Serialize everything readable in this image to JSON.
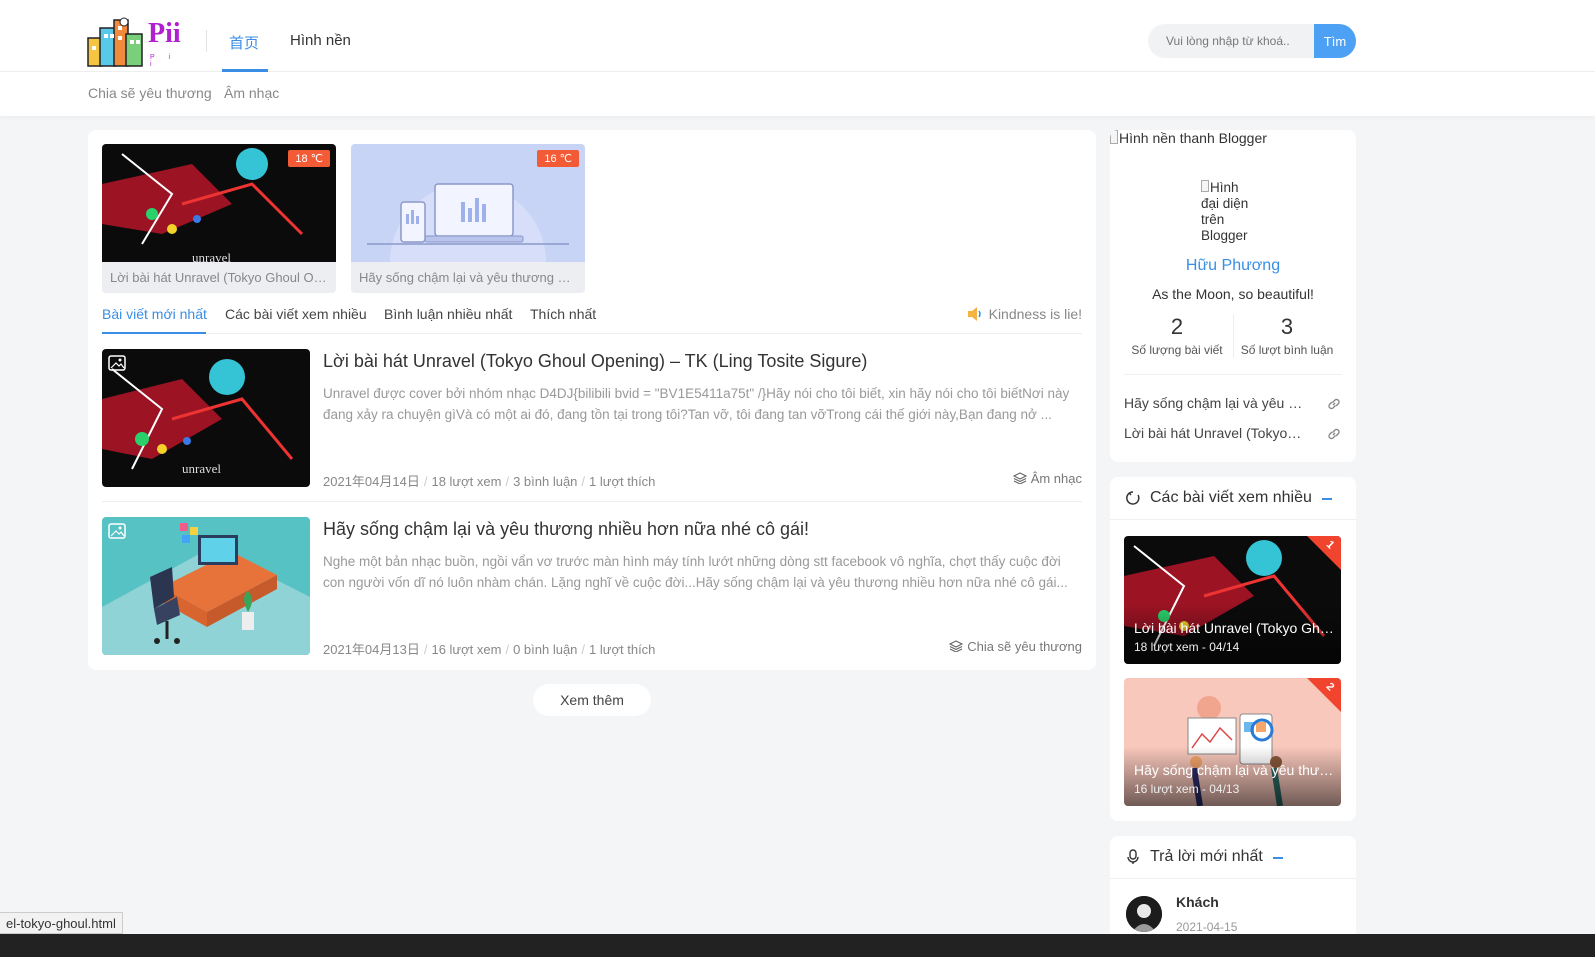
{
  "header": {
    "logo_text": "Pii",
    "logo_sub": "P i i",
    "nav": [
      "首页",
      "Hình nền"
    ],
    "search_placeholder": "Vui lòng nhập từ khoá..",
    "search_button": "Tìm"
  },
  "subnav": [
    "Chia sẽ yêu thương",
    "Âm nhạc"
  ],
  "featured": [
    {
      "caption": "Lời bài hát Unravel (Tokyo Ghoul Opening) – TK",
      "temp": "18 ℃"
    },
    {
      "caption": "Hãy sống chậm lại và yêu thương nhiều hơn nữa",
      "temp": "16 ℃"
    }
  ],
  "tabs": [
    "Bài viết mới nhất",
    "Các bài viết xem nhiều",
    "Bình luận nhiều nhất",
    "Thích nhất"
  ],
  "kindness": "Kindness is lie!",
  "posts": [
    {
      "title": "Lời bài hát Unravel (Tokyo Ghoul Opening) – TK (Ling Tosite Sigure)",
      "excerpt": "Unravel được cover bởi nhóm nhạc D4DJ{bilibili bvid = \"BV1E5411a75t\" /}Hãy nói cho tôi biết, xin hãy nói cho tôi biếtNơi này đang xảy ra chuyện gìVà có một ai đó, đang tồn tại trong tôi?Tan vỡ, tôi đang tan vỡTrong cái thế giới này,Bạn đang nở ...",
      "date": "2021年04月14日",
      "views": "18 lượt xem",
      "comments": "3 bình luận",
      "likes": "1 lượt thích",
      "category": "Âm nhạc"
    },
    {
      "title": "Hãy sống chậm lại và yêu thương nhiều hơn nữa nhé cô gái!",
      "excerpt": "Nghe một bản nhạc buồn, ngồi vẩn vơ trước màn hình máy tính lướt những dòng stt facebook vô nghĩa, chợt thấy cuộc đời con người vốn dĩ nó luôn nhàm chán. Lặng nghĩ về cuộc đời...Hãy sống chậm lại và yêu thương nhiều hơn nữa nhé cô gái...",
      "date": "2021年04月13日",
      "views": "16 lượt xem",
      "comments": "0 bình luận",
      "likes": "1 lượt thích",
      "category": "Chia sẽ yêu thương"
    }
  ],
  "more_button": "Xem thêm",
  "profile": {
    "banner_alt": "Hình nền thanh Blogger",
    "avatar_alt": "Hình đại diện trên Blogger",
    "name": "Hữu Phương",
    "bio": "As the Moon, so beautiful!",
    "post_count": "2",
    "post_label": "Số lượng bài viết",
    "comment_count": "3",
    "comment_label": "Số lượt bình luận",
    "links": [
      "Hãy sống chậm lại và yêu thương nhiều hơn nữa nhé cô gái!",
      "Lời bài hát Unravel (Tokyo Ghoul Opening)"
    ]
  },
  "popular": {
    "title": "Các bài viết xem nhiều",
    "items": [
      {
        "rank": "1",
        "title": "Lời bài hát Unravel (Tokyo Ghoul Opening)",
        "meta": "18 lượt xem - 04/14"
      },
      {
        "rank": "2",
        "title": "Hãy sống chậm lại và yêu thương nhiều hơn nữa",
        "meta": "16 lượt xem - 04/13"
      }
    ]
  },
  "replies": {
    "title": "Trả lời mới nhất",
    "name": "Khách",
    "date": "2021-04-15"
  },
  "statusbar": "el-tokyo-ghoul.html",
  "colors": {
    "accent": "#3a8ee6",
    "badge": "#f35b36",
    "rank": "#f0442e",
    "logo": "#b21fd0"
  }
}
